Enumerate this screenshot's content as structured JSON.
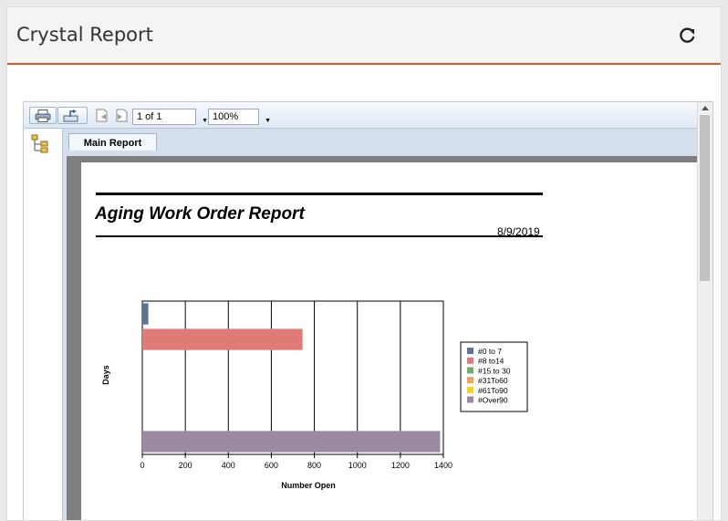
{
  "panel": {
    "title": "Crystal Report",
    "refresh_icon": "refresh-icon"
  },
  "viewer": {
    "toolbar": {
      "print_icon": "printer-icon",
      "export_icon": "export-icon",
      "prev_page_icon": "prev-page-icon",
      "next_page_icon": "next-page-icon",
      "page_select_value": "1 of 1",
      "zoom_select_value": "100%"
    },
    "group_tree_icon": "group-tree-icon",
    "tab_label": "Main Report"
  },
  "report": {
    "title": "Aging Work Order Report",
    "date": "8/9/2019"
  },
  "chart_data": {
    "type": "bar",
    "orientation": "horizontal",
    "xlabel": "Number Open",
    "ylabel": "Days",
    "xlim": [
      0,
      1400
    ],
    "xticks": [
      0,
      200,
      400,
      600,
      800,
      1000,
      1200,
      1400
    ],
    "grid": true,
    "legend_position": "right",
    "series": [
      {
        "name": "#0 to 7",
        "value": 28,
        "color": "#5c7394"
      },
      {
        "name": "#8 to14",
        "value": 745,
        "color": "#de7b76"
      },
      {
        "name": "#15 to 30",
        "value": 0,
        "color": "#6fae6b"
      },
      {
        "name": "#31To60",
        "value": 0,
        "color": "#f2a25a"
      },
      {
        "name": "#61To90",
        "value": 0,
        "color": "#f2d21a"
      },
      {
        "name": "#Over90",
        "value": 1385,
        "color": "#9b8aa3"
      }
    ]
  }
}
